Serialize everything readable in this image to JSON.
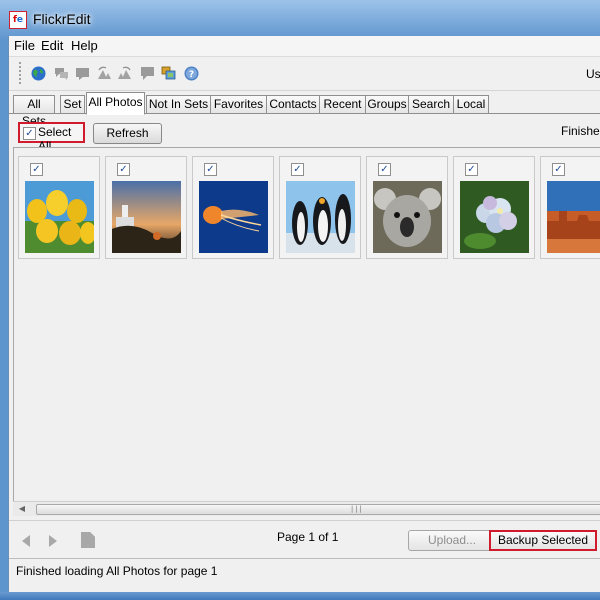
{
  "window": {
    "title": "FlickrEdit",
    "icon_text_1": "f",
    "icon_text_2": "e"
  },
  "menu": {
    "items": [
      "File",
      "Edit",
      "Help"
    ]
  },
  "toolbar": {
    "icons": [
      "globe-icon",
      "chat-icon",
      "photo-icon",
      "rotate-left-icon",
      "rotate-right-icon",
      "comment-icon",
      "frames-icon",
      "help-icon"
    ],
    "right_text": "Use"
  },
  "tabs": {
    "items": [
      "All Sets",
      "Set",
      "All Photos",
      "Not In Sets",
      "Favorites",
      "Contacts",
      "Recent",
      "Groups",
      "Search",
      "Local"
    ],
    "active": "All Photos"
  },
  "actions": {
    "select_all": "Select All",
    "refresh": "Refresh",
    "status_right": "Finished"
  },
  "photos": [
    {
      "subject": "tulips",
      "checked": true
    },
    {
      "subject": "lighthouse",
      "checked": true
    },
    {
      "subject": "jellyfish",
      "checked": true
    },
    {
      "subject": "penguins",
      "checked": true
    },
    {
      "subject": "koala",
      "checked": true
    },
    {
      "subject": "hydrangea",
      "checked": true
    },
    {
      "subject": "desert",
      "checked": true
    }
  ],
  "footer": {
    "page_info": "Page 1 of 1",
    "upload": "Upload...",
    "backup_selected": "Backup Selected"
  },
  "statusbar": {
    "message": "Finished loading All Photos for page 1"
  },
  "colors": {
    "highlight": "#d01b2c",
    "title_glow": "#ffffff",
    "window_frame": "#5f95cd"
  }
}
